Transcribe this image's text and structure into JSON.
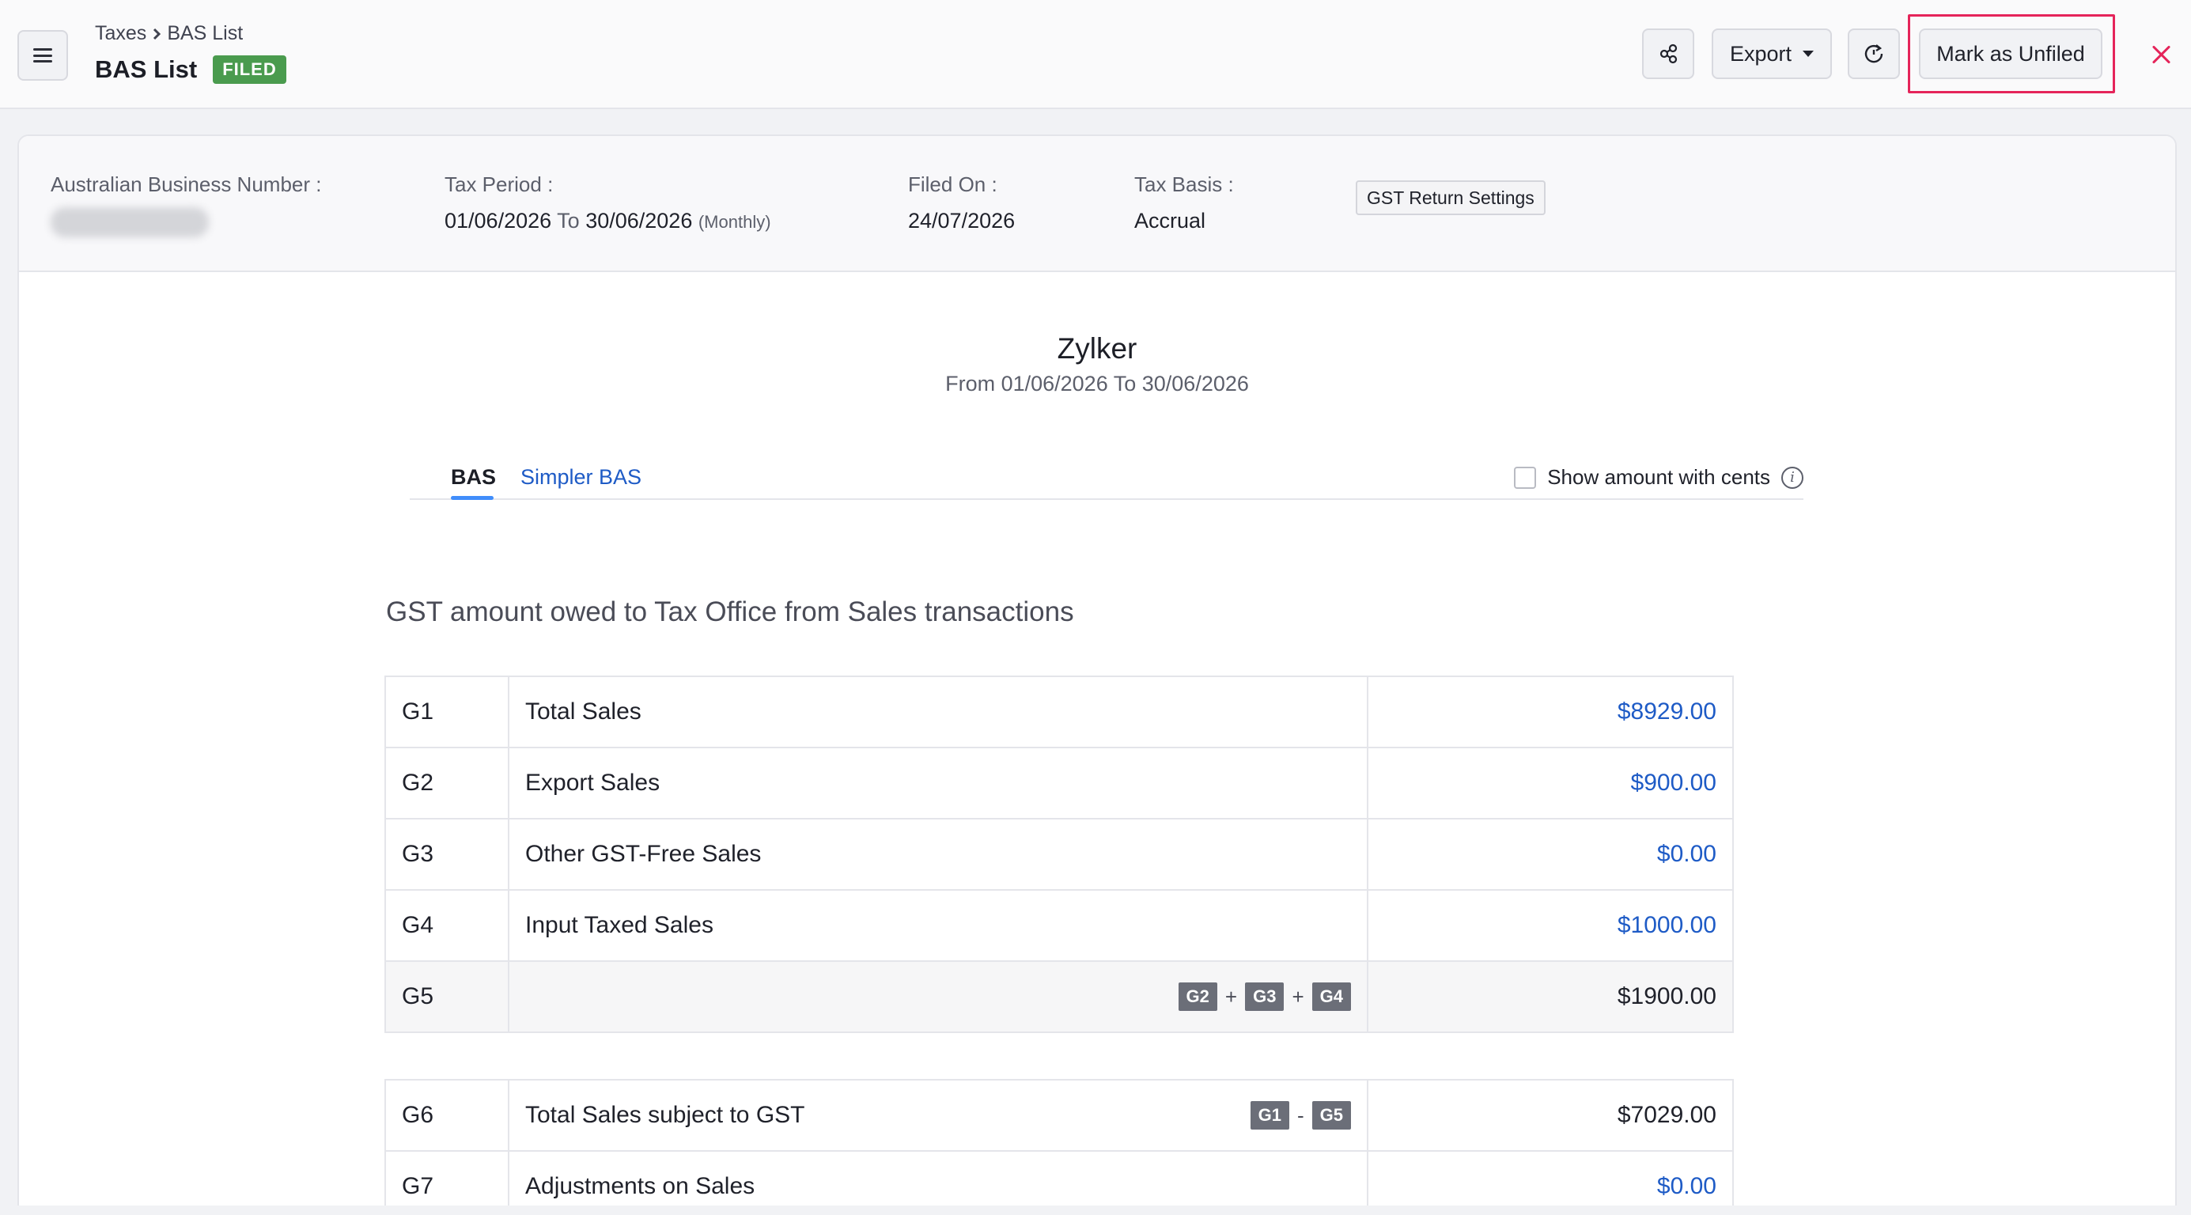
{
  "header": {
    "breadcrumb": {
      "parent": "Taxes",
      "current": "BAS List"
    },
    "title": "BAS List",
    "status": "FILED",
    "buttons": {
      "share_icon": "share-icon",
      "export": "Export",
      "refresh_icon": "refresh-icon",
      "mark_unfiled": "Mark as Unfiled",
      "close_icon": "close-icon"
    }
  },
  "info": {
    "abn_label": "Australian Business Number :",
    "tax_period_label": "Tax Period :",
    "tax_period_from": "01/06/2026",
    "tax_period_to_word": "To",
    "tax_period_to": "30/06/2026",
    "tax_period_freq": "(Monthly)",
    "filed_on_label": "Filed On :",
    "filed_on": "24/07/2026",
    "tax_basis_label": "Tax Basis :",
    "tax_basis": "Accrual",
    "gst_settings_button": "GST Return Settings"
  },
  "report": {
    "org_name": "Zylker",
    "period": "From 01/06/2026  To 30/06/2026"
  },
  "tabs": {
    "bas": "BAS",
    "simpler_bas": "Simpler BAS",
    "show_cents": "Show amount with cents",
    "show_cents_checked": false
  },
  "section": {
    "title": "GST amount owed to Tax Office from Sales transactions"
  },
  "rows": [
    {
      "code": "G1",
      "label": "Total Sales",
      "amount": "$8929.00"
    },
    {
      "code": "G2",
      "label": "Export Sales",
      "amount": "$900.00"
    },
    {
      "code": "G3",
      "label": "Other GST-Free Sales",
      "amount": "$0.00"
    },
    {
      "code": "G4",
      "label": "Input Taxed Sales",
      "amount": "$1000.00"
    },
    {
      "code": "G5",
      "label": "",
      "formula": [
        "G2",
        "+",
        "G3",
        "+",
        "G4"
      ],
      "amount": "$1900.00"
    }
  ],
  "rows2": [
    {
      "code": "G6",
      "label": "Total Sales subject to GST",
      "formula": [
        "G1",
        "-",
        "G5"
      ],
      "amount": "$7029.00"
    },
    {
      "code": "G7",
      "label": "Adjustments on Sales",
      "amount": "$0.00"
    }
  ],
  "colors": {
    "accent_link": "#1e5bc6",
    "filed_badge": "#4a9b4e",
    "highlight": "#e5245a",
    "tab_underline": "#408dfb"
  }
}
